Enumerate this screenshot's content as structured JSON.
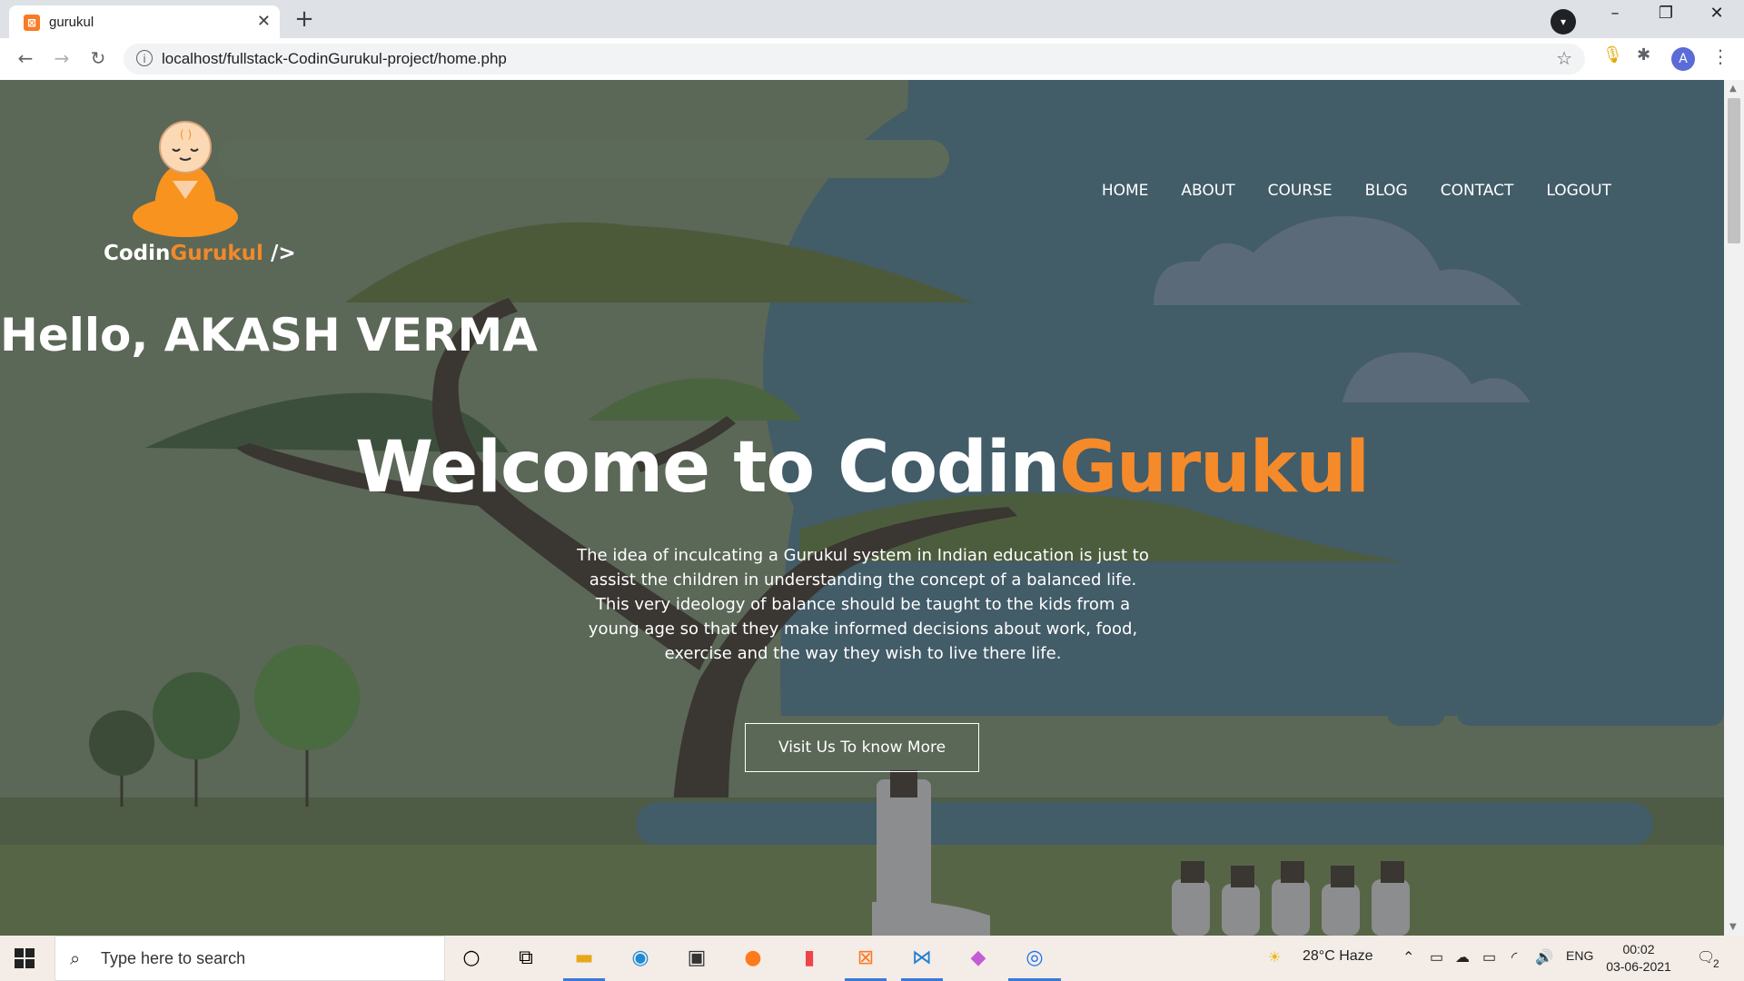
{
  "browser": {
    "tab_title": "gurukul",
    "tab_favicon": "xampp-icon",
    "url": "localhost/fullstack-CodinGurukul-project/home.php",
    "profile_initial": "A"
  },
  "site": {
    "brand_part1": "Codin",
    "brand_part2": "Gurukul",
    "brand_part3": " />",
    "nav": [
      "HOME",
      "ABOUT",
      "COURSE",
      "BLOG",
      "CONTACT",
      "LOGOUT"
    ],
    "greeting": "Hello, AKASH VERMA",
    "welcome_prefix": "Welcome to Codin",
    "welcome_accent": "Gurukul",
    "description": "The idea of inculcating a Gurukul system in Indian education is just to assist the children in understanding the concept of a balanced life. This very ideology of balance should be taught to the kids from a young age so that they make informed decisions about work, food, exercise and the way they wish to live there life.",
    "cta_label": "Visit Us To know More",
    "accent_color": "#f58a2a"
  },
  "taskbar": {
    "search_placeholder": "Type here to search",
    "weather": "28°C  Haze",
    "language": "ENG",
    "time": "00:02",
    "date": "03-06-2021",
    "notifications": "2"
  }
}
